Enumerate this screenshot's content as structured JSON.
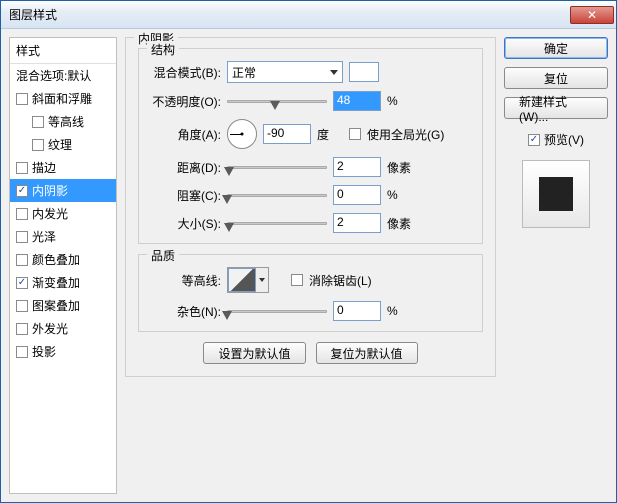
{
  "window": {
    "title": "图层样式"
  },
  "sidebar": {
    "header": "样式",
    "items": [
      {
        "label": "混合选项:默认",
        "hasCheckbox": false,
        "checked": false,
        "indent": false
      },
      {
        "label": "斜面和浮雕",
        "hasCheckbox": true,
        "checked": false,
        "indent": false
      },
      {
        "label": "等高线",
        "hasCheckbox": true,
        "checked": false,
        "indent": true
      },
      {
        "label": "纹理",
        "hasCheckbox": true,
        "checked": false,
        "indent": true
      },
      {
        "label": "描边",
        "hasCheckbox": true,
        "checked": false,
        "indent": false
      },
      {
        "label": "内阴影",
        "hasCheckbox": true,
        "checked": true,
        "indent": false,
        "selected": true
      },
      {
        "label": "内发光",
        "hasCheckbox": true,
        "checked": false,
        "indent": false
      },
      {
        "label": "光泽",
        "hasCheckbox": true,
        "checked": false,
        "indent": false
      },
      {
        "label": "颜色叠加",
        "hasCheckbox": true,
        "checked": false,
        "indent": false
      },
      {
        "label": "渐变叠加",
        "hasCheckbox": true,
        "checked": true,
        "indent": false
      },
      {
        "label": "图案叠加",
        "hasCheckbox": true,
        "checked": false,
        "indent": false
      },
      {
        "label": "外发光",
        "hasCheckbox": true,
        "checked": false,
        "indent": false
      },
      {
        "label": "投影",
        "hasCheckbox": true,
        "checked": false,
        "indent": false
      }
    ]
  },
  "panel": {
    "title": "内阴影",
    "structure": {
      "legend": "结构",
      "blendMode": {
        "label": "混合模式(B):",
        "value": "正常"
      },
      "opacity": {
        "label": "不透明度(O):",
        "value": "48",
        "unit": "%"
      },
      "angle": {
        "label": "角度(A):",
        "value": "-90",
        "unit": "度",
        "globalLabel": "使用全局光(G)",
        "globalChecked": false
      },
      "distance": {
        "label": "距离(D):",
        "value": "2",
        "unit": "像素"
      },
      "choke": {
        "label": "阻塞(C):",
        "value": "0",
        "unit": "%"
      },
      "size": {
        "label": "大小(S):",
        "value": "2",
        "unit": "像素"
      }
    },
    "quality": {
      "legend": "品质",
      "contour": {
        "label": "等高线:",
        "antiAliasLabel": "消除锯齿(L)",
        "antiAliasChecked": false
      },
      "noise": {
        "label": "杂色(N):",
        "value": "0",
        "unit": "%"
      }
    },
    "buttons": {
      "default": "设置为默认值",
      "reset": "复位为默认值"
    }
  },
  "right": {
    "ok": "确定",
    "cancel": "复位",
    "newStyle": "新建样式(W)...",
    "previewLabel": "预览(V)",
    "previewChecked": true
  }
}
